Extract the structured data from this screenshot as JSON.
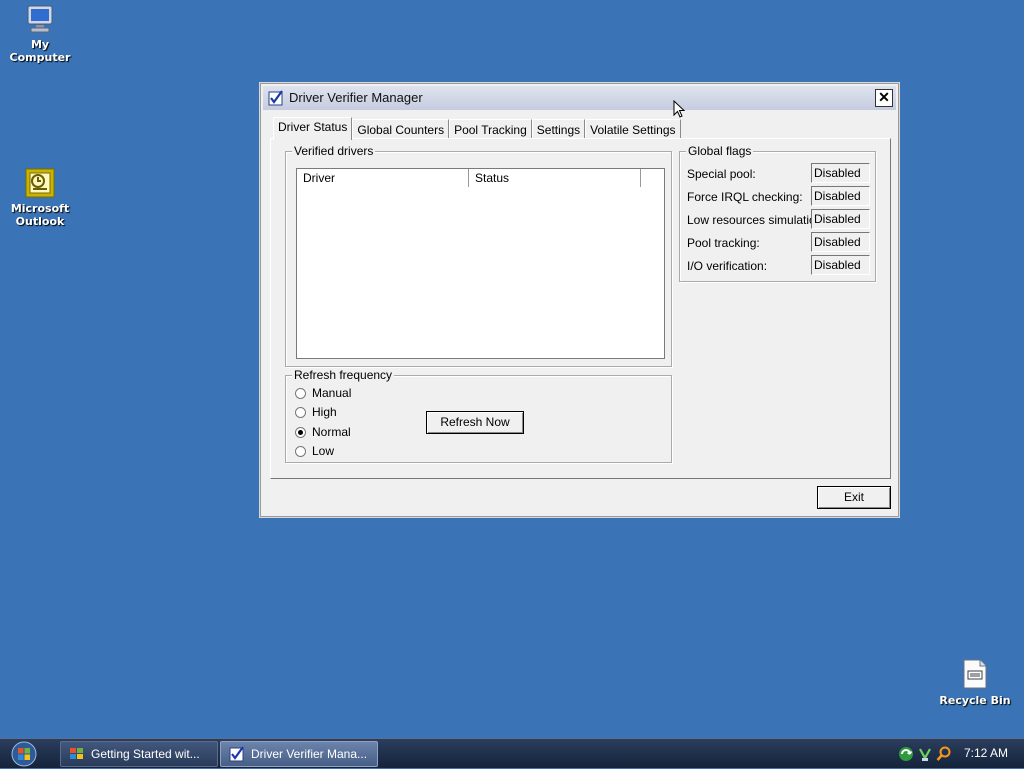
{
  "desktop": {
    "icons": [
      {
        "label": "My Computer"
      },
      {
        "label": "Microsoft Outlook"
      },
      {
        "label": "Recycle Bin"
      }
    ]
  },
  "window": {
    "title": "Driver Verifier Manager",
    "close_label": "✕",
    "tabs": [
      {
        "label": "Driver Status",
        "active": true
      },
      {
        "label": "Global Counters"
      },
      {
        "label": "Pool Tracking"
      },
      {
        "label": "Settings"
      },
      {
        "label": "Volatile Settings"
      }
    ],
    "verified_drivers": {
      "legend": "Verified drivers",
      "columns": [
        "Driver",
        "Status"
      ],
      "rows": []
    },
    "refresh_frequency": {
      "legend": "Refresh frequency",
      "options": [
        {
          "label": "Manual",
          "checked": false
        },
        {
          "label": "High",
          "checked": false
        },
        {
          "label": "Normal",
          "checked": true
        },
        {
          "label": "Low",
          "checked": false
        }
      ],
      "refresh_button": "Refresh Now"
    },
    "global_flags": {
      "legend": "Global flags",
      "flags": [
        {
          "label": "Special pool:",
          "value": "Disabled"
        },
        {
          "label": "Force IRQL checking:",
          "value": "Disabled"
        },
        {
          "label": "Low resources simulation:",
          "value": "Disabled"
        },
        {
          "label": "Pool tracking:",
          "value": "Disabled"
        },
        {
          "label": "I/O verification:",
          "value": "Disabled"
        }
      ]
    },
    "exit_button": "Exit"
  },
  "taskbar": {
    "buttons": [
      {
        "label": "Getting Started wit...",
        "active": false
      },
      {
        "label": "Driver Verifier Mana...",
        "active": true
      }
    ],
    "clock": "7:12 AM"
  },
  "colors": {
    "desktop": "#3a74b6",
    "window_bg": "#f0f0f0",
    "taskbar": "#1d2d4a"
  }
}
